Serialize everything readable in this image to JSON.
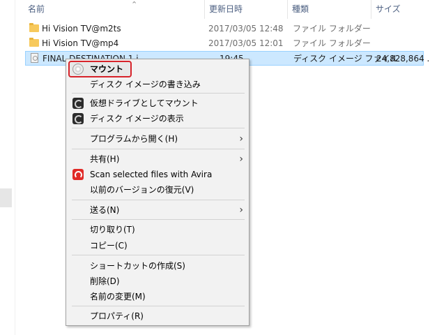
{
  "columns": {
    "name": "名前",
    "date": "更新日時",
    "type": "種類",
    "size": "サイズ"
  },
  "files": [
    {
      "name": "Hi Vision TV@m2ts",
      "date": "2017/03/05 12:48",
      "type": "ファイル フォルダー",
      "size": "",
      "icon": "folder-icon"
    },
    {
      "name": "Hi Vision TV@mp4",
      "date": "2017/03/05 12:01",
      "type": "ファイル フォルダー",
      "size": "",
      "icon": "folder-icon"
    },
    {
      "name": "FINAL DESTINATION 1.i",
      "date": "19:45",
      "type": "ディスク イメージ ファイル",
      "size": "24,828,864 ...",
      "icon": "disc-image-icon",
      "selected": true
    }
  ],
  "context_menu": {
    "items": [
      {
        "label": "マウント",
        "bold": true,
        "icon": "disc-icon"
      },
      {
        "label": "ディスク イメージの書き込み"
      },
      {
        "label": "仮想ドライブとしてマウント",
        "icon": "daemon-tools-icon"
      },
      {
        "label": "ディスク イメージの表示",
        "icon": "daemon-tools-icon"
      },
      {
        "label": "プログラムから開く(H)",
        "submenu": true
      },
      {
        "label": "共有(H)",
        "submenu": true
      },
      {
        "label": "Scan selected files with Avira",
        "icon": "avira-icon"
      },
      {
        "label": "以前のバージョンの復元(V)"
      },
      {
        "label": "送る(N)",
        "submenu": true
      },
      {
        "label": "切り取り(T)"
      },
      {
        "label": "コピー(C)"
      },
      {
        "label": "ショートカットの作成(S)"
      },
      {
        "label": "削除(D)"
      },
      {
        "label": "名前の変更(M)"
      },
      {
        "label": "プロパティ(R)"
      }
    ]
  },
  "colors": {
    "selection_bg": "#cce8ff",
    "highlight_border": "#d7232a",
    "menu_bg": "#f2f2f2"
  }
}
